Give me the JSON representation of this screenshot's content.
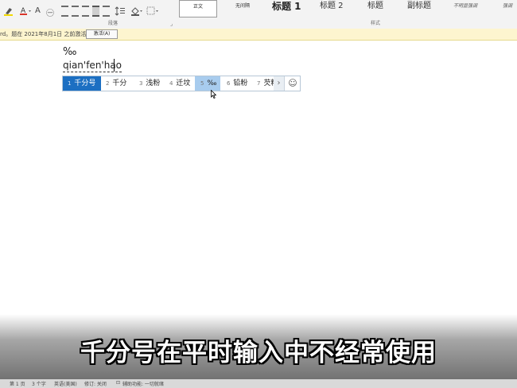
{
  "ribbon": {
    "font_tools": {
      "highlight_icon": "highlighter-icon",
      "font_color_icon": "font-color-icon",
      "char_shading_label": "A",
      "enclose_char_label": "㊀"
    },
    "paragraph_tools": {
      "align_left_icon": "align-left-icon",
      "align_center_icon": "align-center-icon",
      "align_right_icon": "align-right-icon",
      "justify_icon": "justify-icon",
      "distributed_icon": "distributed-icon",
      "line_spacing_icon": "line-spacing-icon",
      "shading_icon": "paint-bucket-icon",
      "borders_icon": "borders-icon"
    },
    "groups": {
      "paragraph_label": "段落",
      "styles_label": "样式"
    },
    "styles": [
      {
        "label": "正文"
      },
      {
        "label": "无间隔"
      },
      {
        "label": "标题 1"
      },
      {
        "label": "标题 2"
      },
      {
        "label": "标题"
      },
      {
        "label": "副标题"
      },
      {
        "label": "不明显强调"
      },
      {
        "label": "强调"
      }
    ]
  },
  "infobar": {
    "text": "rd。题在 2021年8月1日 之前激活。",
    "button_label": "激活(A)"
  },
  "document": {
    "line1": "‰",
    "line2": "qian'fen'hao"
  },
  "ime": {
    "candidates": [
      {
        "num": "1",
        "text": "千分号",
        "state": "selected"
      },
      {
        "num": "2",
        "text": "千分",
        "state": "normal"
      },
      {
        "num": "3",
        "text": "浅粉",
        "state": "normal"
      },
      {
        "num": "4",
        "text": "迁坟",
        "state": "normal"
      },
      {
        "num": "5",
        "text": "‰",
        "state": "hover"
      },
      {
        "num": "6",
        "text": "铅粉",
        "state": "normal"
      },
      {
        "num": "7",
        "text": "芡粉",
        "state": "normal"
      }
    ],
    "next_icon": "chevron-right-icon",
    "next_label": "›",
    "emoji_icon": "smiley-icon",
    "emoji_label": "☺"
  },
  "subtitle": "千分号在平时输入中不经常使用",
  "statusbar": {
    "page": "第 1 页",
    "words": "3 个字",
    "language": "英语(美国)",
    "insert_mode": "修订: 关闭",
    "accessibility": "辅助功能: 一切就绪"
  },
  "colors": {
    "candidate_selected": "#1c6fc2",
    "candidate_hover": "#a8ccee",
    "infobar_bg": "#fdf5cf",
    "ribbon_bg": "#f3f3f3",
    "font_color_red": "#d9352b"
  }
}
